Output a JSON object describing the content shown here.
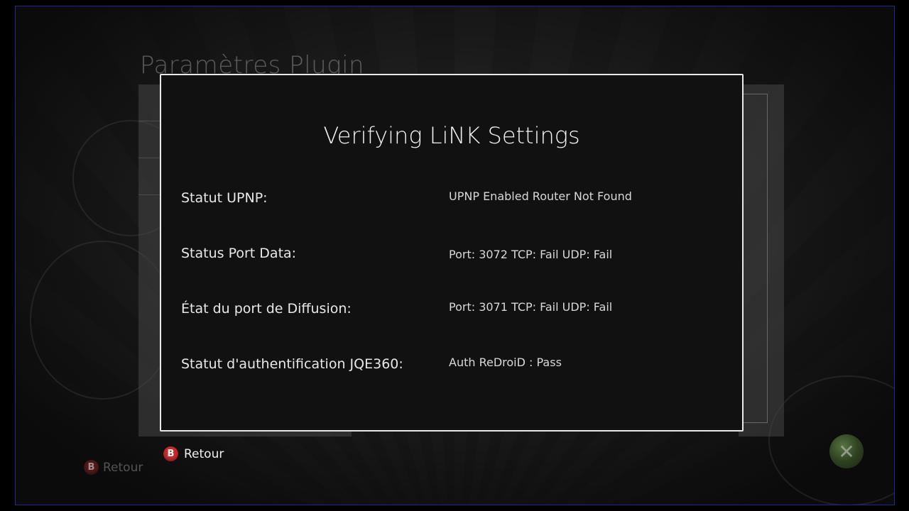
{
  "background": {
    "title": "Paramètres Plugin",
    "back_label": "Retour",
    "back_button_glyph": "B"
  },
  "dialog": {
    "title": "Verifying LiNK Settings",
    "rows": [
      {
        "label": "Statut UPNP:",
        "value": "UPNP Enabled Router Not Found"
      },
      {
        "label": "Status Port Data:",
        "value": "Port: 3072 TCP: Fail UDP: Fail"
      },
      {
        "label": "État du port de Diffusion:",
        "value": "Port: 3071 TCP: Fail UDP: Fail"
      },
      {
        "label": "Statut d'authentification JQE360:",
        "value": "Auth ReDroiD : Pass"
      }
    ]
  },
  "footer": {
    "back_label": "Retour",
    "back_button_glyph": "B",
    "xbox_icon": "xbox-logo-icon"
  },
  "colors": {
    "frame_border": "#1d2a8c",
    "b_button": "#c62a2a",
    "dialog_border": "#e9e9e9"
  }
}
